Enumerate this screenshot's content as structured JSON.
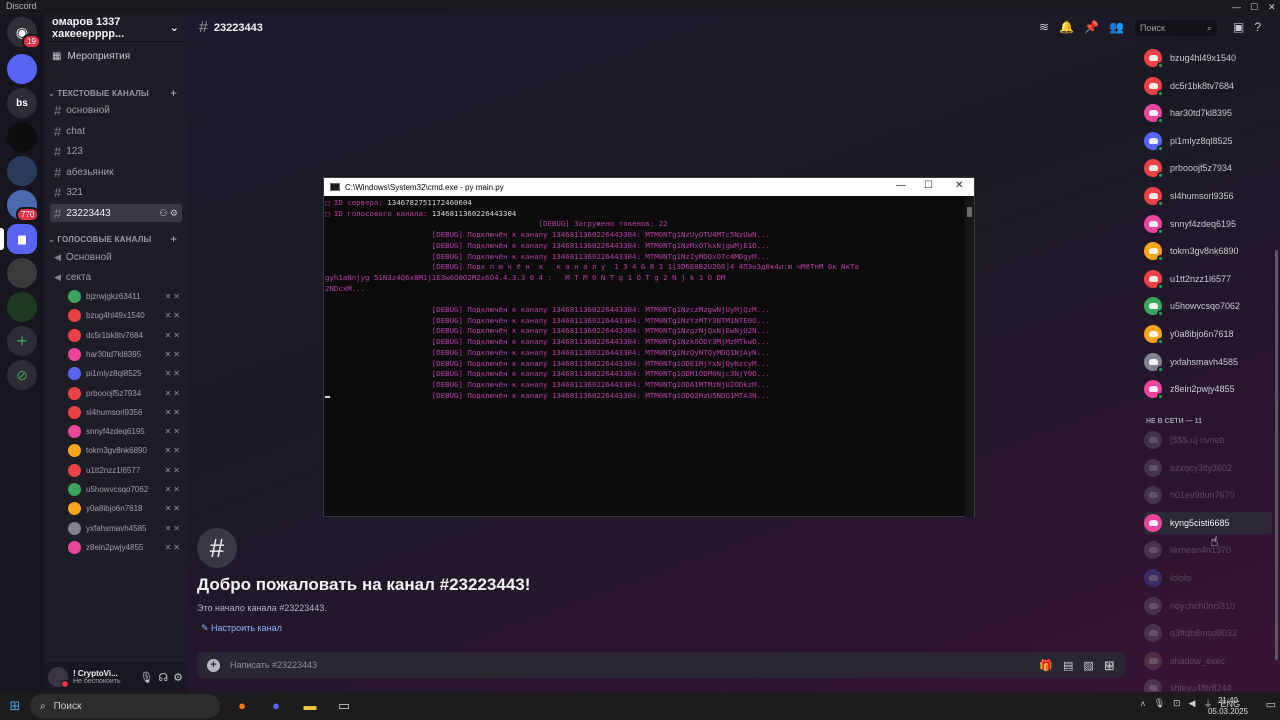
{
  "window": {
    "app_name": "Discord",
    "minimize": "—",
    "maximize": "☐",
    "close": "✕"
  },
  "rail": {
    "home_badge": "19",
    "server_2_label": "bs",
    "server_badge": "770",
    "add_label": "+",
    "discover_label": "⊘"
  },
  "server": {
    "name": "омаров 1337 хакееерррр...",
    "events": "Мероприятия"
  },
  "categories": {
    "text": "ТЕКСТОВЫЕ КАНАЛЫ",
    "voice": "ГОЛОСОВЫЕ КАНАЛЫ"
  },
  "text_channels": [
    "основной",
    "chat",
    "123",
    "абезьяник",
    "321",
    "23223443"
  ],
  "voice_channels": [
    "Основной",
    "секта"
  ],
  "voice_users": [
    {
      "name": "bjzrwjgkz63411",
      "color": "#3ba55c"
    },
    {
      "name": "bzug4hl49x1540",
      "color": "#ed4245"
    },
    {
      "name": "dc5r1bk8tv7684",
      "color": "#ed4245"
    },
    {
      "name": "har30td7kl8395",
      "color": "#eb459e"
    },
    {
      "name": "pi1mlyz8ql8525",
      "color": "#5865f2"
    },
    {
      "name": "prbooojf5z7934",
      "color": "#ed4245"
    },
    {
      "name": "sl4humsorl9356",
      "color": "#ed4245"
    },
    {
      "name": "snnyf4zdeq6195",
      "color": "#eb459e"
    },
    {
      "name": "tokm3gv8nk6890",
      "color": "#faa61a"
    },
    {
      "name": "u1tt2nzz1l6577",
      "color": "#ed4245"
    },
    {
      "name": "u5howvcsqo7062",
      "color": "#3ba55c"
    },
    {
      "name": "y0a8ibjo6n7618",
      "color": "#faa61a"
    },
    {
      "name": "yxfahsmavh4585",
      "color": "#80848e"
    },
    {
      "name": "z8ein2pwjy4855",
      "color": "#eb459e"
    }
  ],
  "user_panel": {
    "name": "! CryptoVi...",
    "status": "Не беспокоить"
  },
  "header": {
    "channel": "23223443",
    "search_placeholder": "Поиск"
  },
  "welcome": {
    "title": "Добро пожаловать на канал #23223443!",
    "subtitle": "Это начало канала #23223443.",
    "setup_link": "Настроить канал"
  },
  "composer": {
    "placeholder": "Написать #23223443"
  },
  "members_online": [
    {
      "name": "bzug4hl49x1540",
      "color": "#ed4245"
    },
    {
      "name": "dc5r1bk8tv7684",
      "color": "#ed4245"
    },
    {
      "name": "har30td7kl8395",
      "color": "#eb459e"
    },
    {
      "name": "pi1mlyz8ql8525",
      "color": "#5865f2"
    },
    {
      "name": "prbooojf5z7934",
      "color": "#ed4245"
    },
    {
      "name": "sl4humsorl9356",
      "color": "#ed4245"
    },
    {
      "name": "snnyf4zdeq6195",
      "color": "#eb459e"
    },
    {
      "name": "tokm3gv8nk6890",
      "color": "#faa61a"
    },
    {
      "name": "u1tt2nzz1l6577",
      "color": "#ed4245"
    },
    {
      "name": "u5howvcsqo7062",
      "color": "#3ba55c"
    },
    {
      "name": "y0a8ibjo6n7618",
      "color": "#faa61a"
    },
    {
      "name": "yxfahsmavh4585",
      "color": "#80848e"
    },
    {
      "name": "z8ein2pwjy4855",
      "color": "#eb459e"
    }
  ],
  "offline_header": "НЕ В СЕТИ — 11",
  "members_offline": [
    {
      "name": "[$$$.u] rivneb",
      "color": "#80848e"
    },
    {
      "name": "azxqcy3lty3602",
      "color": "#80848e"
    },
    {
      "name": "h01ev9dun7670",
      "color": "#80848e"
    },
    {
      "name": "kyng5cisti6685",
      "color": "#eb459e"
    },
    {
      "name": "likmean4n1370",
      "color": "#80848e"
    },
    {
      "name": "lololo",
      "color": "#5865f2"
    },
    {
      "name": "noychch0ncl310",
      "color": "#80848e"
    },
    {
      "name": "q3ftqb8msd9033",
      "color": "#80848e"
    },
    {
      "name": "shadow_exec",
      "color": "#a0706a"
    },
    {
      "name": "shleyu48tr8244",
      "color": "#80848e"
    }
  ],
  "cmd": {
    "title": "C:\\Windows\\System32\\cmd.exe - py  main.py",
    "lines": [
      {
        "text": "□ ID сервера: ",
        "value": "1346782751172460604"
      },
      {
        "text": "□ ID голосового канала: ",
        "value": "1346811360226443304"
      },
      {
        "text": "                                                [DEBUG] Загружено токенов: 22"
      },
      {
        "text": "                        [DEBUG] Подключён к каналу 1346811360226443304: MTM0NTg1NzUyOTU4MTc5NzUwN..."
      },
      {
        "text": "                        [DEBUG] Подключён к каналу 1346811360226443304: MTM0NTg1NzMxOTkxNjgwMjE1O..."
      },
      {
        "text": "                        [DEBUG] Подключён к каналу 1346811360226443304: MTM0NTg1NzIyMDQxOTc4MDgyM..."
      },
      {
        "text": "                        [DEBUG] Подк л ю ч ё н  к   к а н а л у  1 3 4 6 8 1 1[3D6E0B2U2G6]4 4П3о3д0к4л:ю чМёТнМ 0к NкTа"
      },
      {
        "text": "gуh1aNnjyg 51N3z4Q6x8M1j1E3w6O0O2M2x6O4.4.3.3 0 4 :   M T M 0 N T g 1 O T g 2 N j k 1 O DM"
      },
      {
        "text": "2NDcxM..."
      },
      {
        "text": " "
      },
      {
        "text": "                        [DEBUG] Подключён к каналу 1346811360226443304: MTM0NTg1NzczMzgwNjUyMjQzM..."
      },
      {
        "text": "                        [DEBUG] Подключён к каналу 1346811360226443304: MTM0NTg1NzYzMTY3NTM1NTE0O..."
      },
      {
        "text": "                        [DEBUG] Подключён к каналу 1346811360226443304: MTM0NTg1NzgzNjQxNjEwNjU2N..."
      },
      {
        "text": "                        [DEBUG] Подключён к каналу 1346811360226443304: MTM0NTg1Nzk0ODY3MjMzMTkwO..."
      },
      {
        "text": "                        [DEBUG] Подключён к каналу 1346811360226443304: MTM0NTg1NzQyNTQyMDQ1NjAyN..."
      },
      {
        "text": "                        [DEBUG] Подключён к каналу 1346811360226443304: MTM0NTg1ODE1MjYxNjQyNzcyM..."
      },
      {
        "text": "                        [DEBUG] Подключён к каналу 1346811360226443304: MTM0NTg1ODM1ODM0Njc3NjY0O..."
      },
      {
        "text": "                        [DEBUG] Подключён к каналу 1346811360226443304: MTM0NTg1ODA1MTMzNjU2ODkzM..."
      },
      {
        "text": "                        [DEBUG] Подключён к каналу 1346811360226443304: MTM0NTg1ODQ2MzU5NDQ1MTA3N..."
      }
    ]
  },
  "taskbar": {
    "search": "Поиск",
    "lang": "ENG",
    "time": "21:40",
    "date": "05.03.2025"
  },
  "colors": {
    "accent": "#5865f2",
    "online": "#23a55a",
    "dnd": "#e0344a",
    "cmd_text": "#b83fa3"
  }
}
